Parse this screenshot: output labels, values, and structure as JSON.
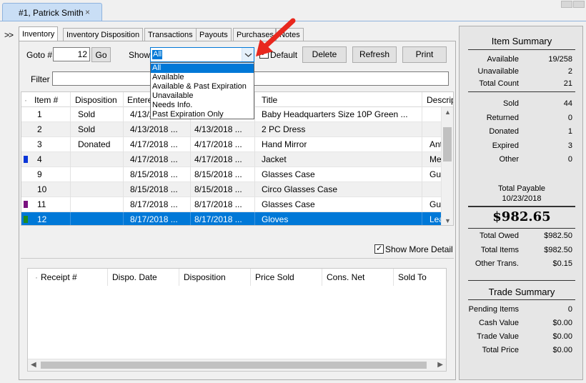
{
  "doc_tab": {
    "title": "#1, Patrick Smith",
    "close": "×"
  },
  "nav_expand": ">>",
  "tabs": [
    "Inventory",
    "Inventory Disposition",
    "Transactions",
    "Payouts",
    "Purchases",
    "Notes"
  ],
  "toolbar": {
    "goto_label": "Goto #",
    "goto_value": "12",
    "go_label": "Go",
    "show_label": "Show",
    "show_value": "All",
    "default_label": "Default",
    "delete_label": "Delete",
    "refresh_label": "Refresh",
    "print_label": "Print",
    "filter_label": "Filter",
    "filter_value": ""
  },
  "show_options": [
    "All",
    "Available",
    "Available & Past Expiration",
    "Unavailable",
    "Needs Info.",
    "Past Expiration Only"
  ],
  "grid": {
    "columns": [
      "Item #",
      "Disposition",
      "Entered",
      "",
      "Title",
      "Description"
    ],
    "rows": [
      {
        "item": "1",
        "disposition": "Sold",
        "entered": "4/13/2018 ...",
        "date2": "4/13/2018 ...",
        "title": "Baby Headquarters Size 10P Green ...",
        "desc": ""
      },
      {
        "item": "2",
        "disposition": "Sold",
        "entered": "4/13/2018 ...",
        "date2": "4/13/2018 ...",
        "title": "2 PC Dress",
        "desc": ""
      },
      {
        "item": "3",
        "disposition": "Donated",
        "entered": "4/17/2018 ...",
        "date2": "4/17/2018 ...",
        "title": "Hand Mirror",
        "desc": "Ant"
      },
      {
        "item": "4",
        "disposition": "",
        "entered": "4/17/2018 ...",
        "date2": "4/17/2018 ...",
        "title": "Jacket",
        "desc": "Me",
        "marker": "#0a36d8"
      },
      {
        "item": "9",
        "disposition": "",
        "entered": "8/15/2018 ...",
        "date2": "8/15/2018 ...",
        "title": "Glasses Case",
        "desc": "Gu"
      },
      {
        "item": "10",
        "disposition": "",
        "entered": "8/15/2018 ...",
        "date2": "8/15/2018 ...",
        "title": "Circo Glasses Case",
        "desc": ""
      },
      {
        "item": "11",
        "disposition": "",
        "entered": "8/17/2018 ...",
        "date2": "8/17/2018 ...",
        "title": "Glasses Case",
        "desc": "Gu",
        "marker": "#7b1280"
      },
      {
        "item": "12",
        "disposition": "",
        "entered": "8/17/2018 ...",
        "date2": "8/17/2018 ...",
        "title": "Gloves",
        "desc": "Lea",
        "marker": "#1e8c1e",
        "selected": true
      }
    ]
  },
  "show_more_detail_label": "Show More Detail",
  "receipts": {
    "columns": [
      "Receipt #",
      "Dispo. Date",
      "Disposition",
      "Price Sold",
      "Cons. Net",
      "Sold To"
    ]
  },
  "item_summary": {
    "title": "Item Summary",
    "counts": [
      {
        "k": "Available",
        "v": "19/258"
      },
      {
        "k": "Unavailable",
        "v": "2"
      },
      {
        "k": "Total Count",
        "v": "21"
      }
    ],
    "dispositions": [
      {
        "k": "Sold",
        "v": "44"
      },
      {
        "k": "Returned",
        "v": "0"
      },
      {
        "k": "Donated",
        "v": "1"
      },
      {
        "k": "Expired",
        "v": "3"
      },
      {
        "k": "Other",
        "v": "0"
      }
    ],
    "total_payable_label": "Total Payable",
    "total_payable_date": "10/23/2018",
    "total_payable_value": "$982.65",
    "totals": [
      {
        "k": "Total Owed",
        "v": "$982.50"
      },
      {
        "k": "Total Items",
        "v": "$982.50"
      },
      {
        "k": "Other Trans.",
        "v": "$0.15"
      }
    ]
  },
  "trade_summary": {
    "title": "Trade Summary",
    "rows": [
      {
        "k": "Pending Items",
        "v": "0"
      },
      {
        "k": "Cash Value",
        "v": "$0.00"
      },
      {
        "k": "Trade Value",
        "v": "$0.00"
      },
      {
        "k": "Total Price",
        "v": "$0.00"
      }
    ]
  },
  "colors": {
    "selection": "#0078d7",
    "arrow": "#e8281e"
  }
}
